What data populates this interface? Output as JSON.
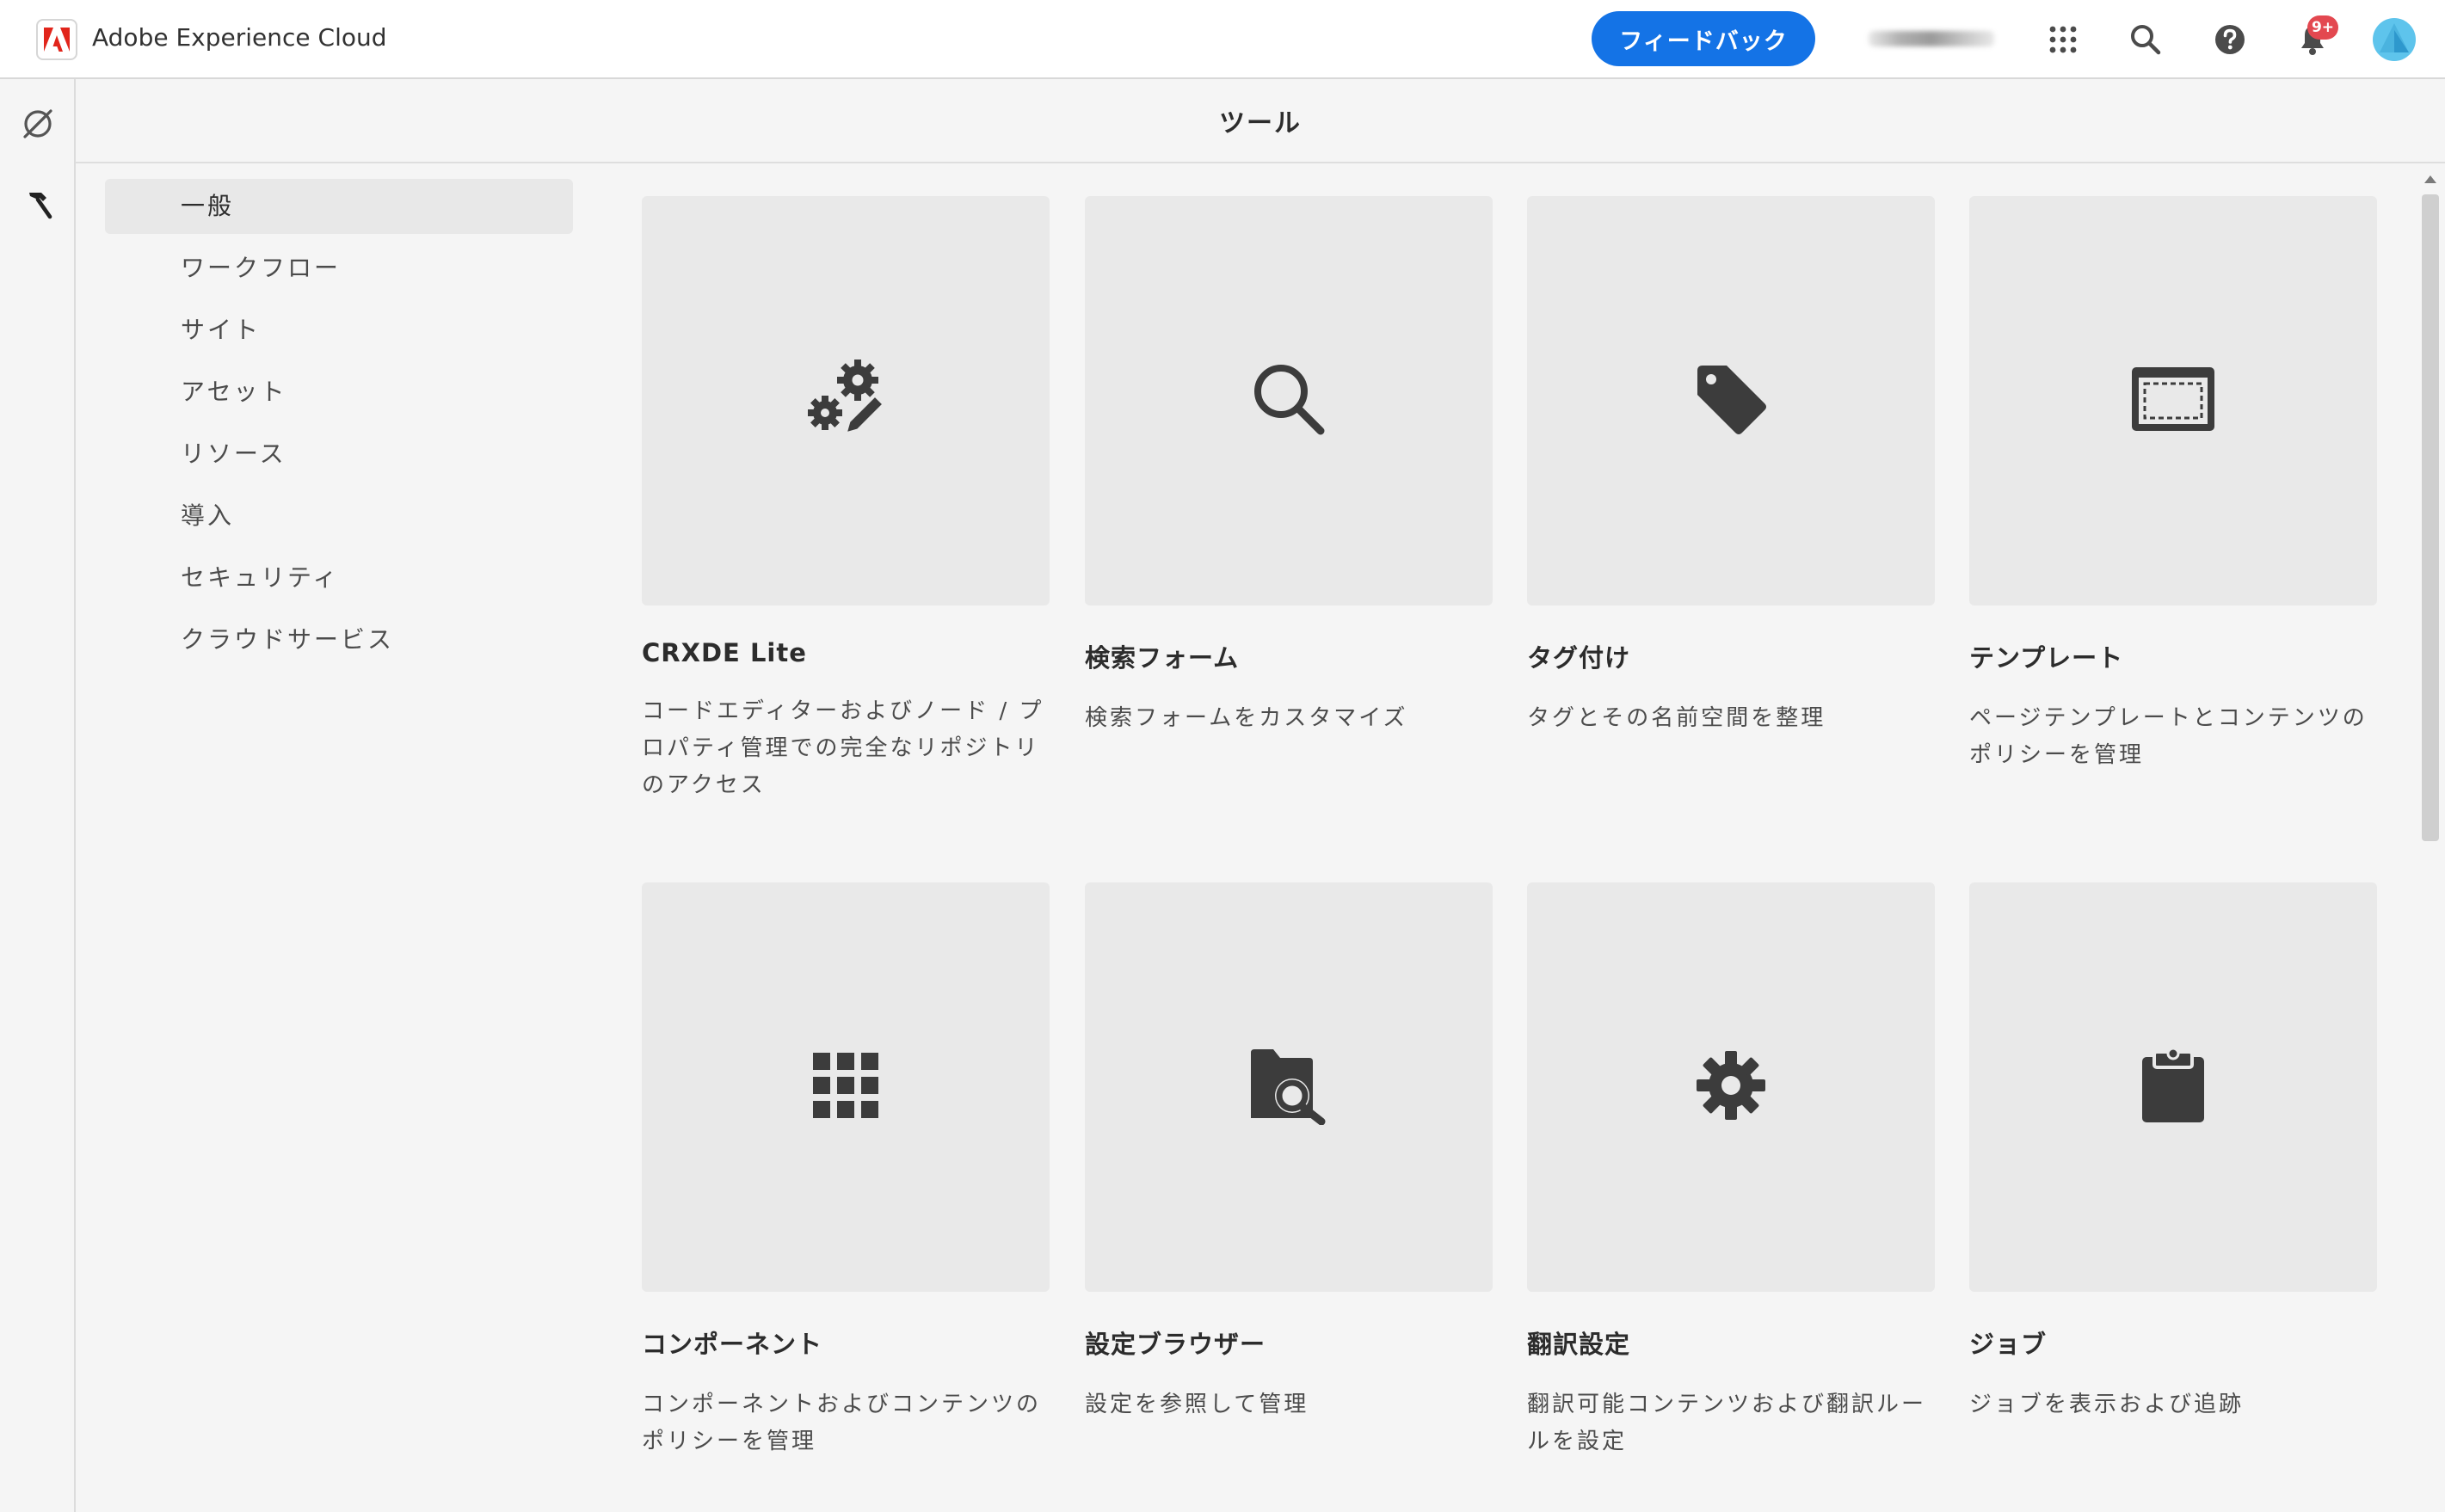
{
  "header": {
    "brand": "Adobe Experience Cloud",
    "feedback_label": "フィードバック",
    "notification_count": "9+",
    "colors": {
      "feedback": "#1473e6",
      "badge": "#e34850",
      "adobe_red": "#e1251b"
    },
    "icons": [
      "adobe-logo-icon",
      "apps-grid-icon",
      "search-icon",
      "help-icon",
      "bell-icon",
      "avatar"
    ]
  },
  "rail": {
    "icons": [
      "navigation-compass-icon",
      "hammer-tools-icon"
    ]
  },
  "page": {
    "title": "ツール"
  },
  "nav": {
    "items": [
      {
        "label": "一般",
        "active": true
      },
      {
        "label": "ワークフロー"
      },
      {
        "label": "サイト"
      },
      {
        "label": "アセット"
      },
      {
        "label": "リソース"
      },
      {
        "label": "導入"
      },
      {
        "label": "セキュリティ"
      },
      {
        "label": "クラウドサービス"
      }
    ]
  },
  "cards": [
    {
      "title": "CRXDE Lite",
      "desc": "コードエディターおよびノード / プロパティ管理での完全なリポジトリのアクセス",
      "icon": "gears-pencil-icon"
    },
    {
      "title": "検索フォーム",
      "desc": "検索フォームをカスタマイズ",
      "icon": "magnifier-icon"
    },
    {
      "title": "タグ付け",
      "desc": "タグとその名前空間を整理",
      "icon": "tag-icon"
    },
    {
      "title": "テンプレート",
      "desc": "ページテンプレートとコンテンツのポリシーを管理",
      "icon": "template-icon"
    },
    {
      "title": "コンポーネント",
      "desc": "コンポーネントおよびコンテンツのポリシーを管理",
      "icon": "grid-icon"
    },
    {
      "title": "設定ブラウザー",
      "desc": "設定を参照して管理",
      "icon": "folder-search-icon"
    },
    {
      "title": "翻訳設定",
      "desc": "翻訳可能コンテンツおよび翻訳ルールを設定",
      "icon": "gear-icon"
    },
    {
      "title": "ジョブ",
      "desc": "ジョブを表示および追跡",
      "icon": "clipboard-icon"
    }
  ]
}
